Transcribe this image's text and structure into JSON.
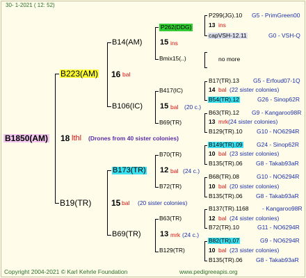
{
  "header": {
    "date": "30-   1-2021  (  12:  52)"
  },
  "footer": {
    "copyright": "Copyright 2004-2021 © Karl Kehrle Foundation",
    "site": "www.pedigreeapis.org"
  },
  "root": {
    "name": "B1850(AM)",
    "num": "18",
    "tag": "lthl",
    "note": "(Drones from 40 sister colonies)"
  },
  "gen1": [
    {
      "name": "B223(AM)",
      "num": "16",
      "tag": "bal"
    },
    {
      "name": "B19(TR)",
      "num": "15",
      "tag": "bal",
      "note": "(20 sister colonies)"
    }
  ],
  "gen2": [
    {
      "name": "B14(AM)",
      "num": "15",
      "tag": "ins"
    },
    {
      "name": "B106(IC)",
      "num": "15",
      "tag": "bal",
      "note": "(20 c.)"
    },
    {
      "name": "B173(TR)",
      "num": "12",
      "tag": "bal",
      "note": "(24 c.)"
    },
    {
      "name": "B69(TR)",
      "num": "13",
      "tag": "mrk",
      "note": "(24 c.)"
    }
  ],
  "gen3": [
    {
      "name": "P262(DDG)"
    },
    {
      "name": "Bmix15(..)"
    },
    {
      "name": "B417(IC)",
      "num": "14",
      "tag": "bal",
      "note": "(22 sister colonies)"
    },
    {
      "name": "B69(TR)",
      "num": "13",
      "tag": "mrk",
      "note": "(24 sister colonies)"
    },
    {
      "name": "B70(TR)",
      "num": "10",
      "tag": "bal",
      "note": "(23 sister colonies)"
    },
    {
      "name": "B72(TR)",
      "num": "10",
      "tag": "bal",
      "note": "(20 sister colonies)"
    },
    {
      "name": "B63(TR)",
      "num": "12",
      "tag": "bal",
      "note": "(24 sister colonies)"
    },
    {
      "name": "B129(TR)",
      "num": "10",
      "tag": "bal",
      "note": "(23 sister colonies)"
    }
  ],
  "gen3_extra": {
    "ins_num": "13",
    "ins_tag": "ins",
    "no_more": "no more"
  },
  "gen4": [
    {
      "name": "P299(JG).10",
      "code": "G5 - PrimGreen00"
    },
    {
      "name": "capVSH-12.11",
      "code": "G0 - VSH-Q"
    },
    {
      "name": "B17(TR).13",
      "code": "G5 - Erfoud07-1Q"
    },
    {
      "name": "B54(TR).12",
      "code": "G26 - Sinop62R"
    },
    {
      "name": "B63(TR).12",
      "code": "G9 - Kangaroo98R"
    },
    {
      "name": "B129(TR).10",
      "code": "G10 - NO6294R"
    },
    {
      "name": "B149(TR).09",
      "code": "G24 - Sinop62R"
    },
    {
      "name": "B135(TR).06",
      "code": "G8 - Takab93aR"
    },
    {
      "name": "B68(TR).08",
      "code": "G10 - NO6294R"
    },
    {
      "name": "B135(TR).06",
      "code": "G8 - Takab93aR"
    },
    {
      "name": "B137(TR).1168",
      "code": "- Kangaroo98R"
    },
    {
      "name": "B72(TR).10",
      "code": "G11 - NO6294R"
    },
    {
      "name": "B82(TR).07",
      "code": "G9 - NO6294R"
    },
    {
      "name": "B135(TR).06",
      "code": "G8 - Takab93aR"
    }
  ],
  "colors": {
    "frame": "#fffde9",
    "green_text": "#2a6e2a",
    "blue": "#1d2faa",
    "red": "#dd1010",
    "cyan": "#3be0f0",
    "yellow": "#ffff33",
    "pink": "#f4c6f0",
    "green_box": "#33cc33"
  }
}
